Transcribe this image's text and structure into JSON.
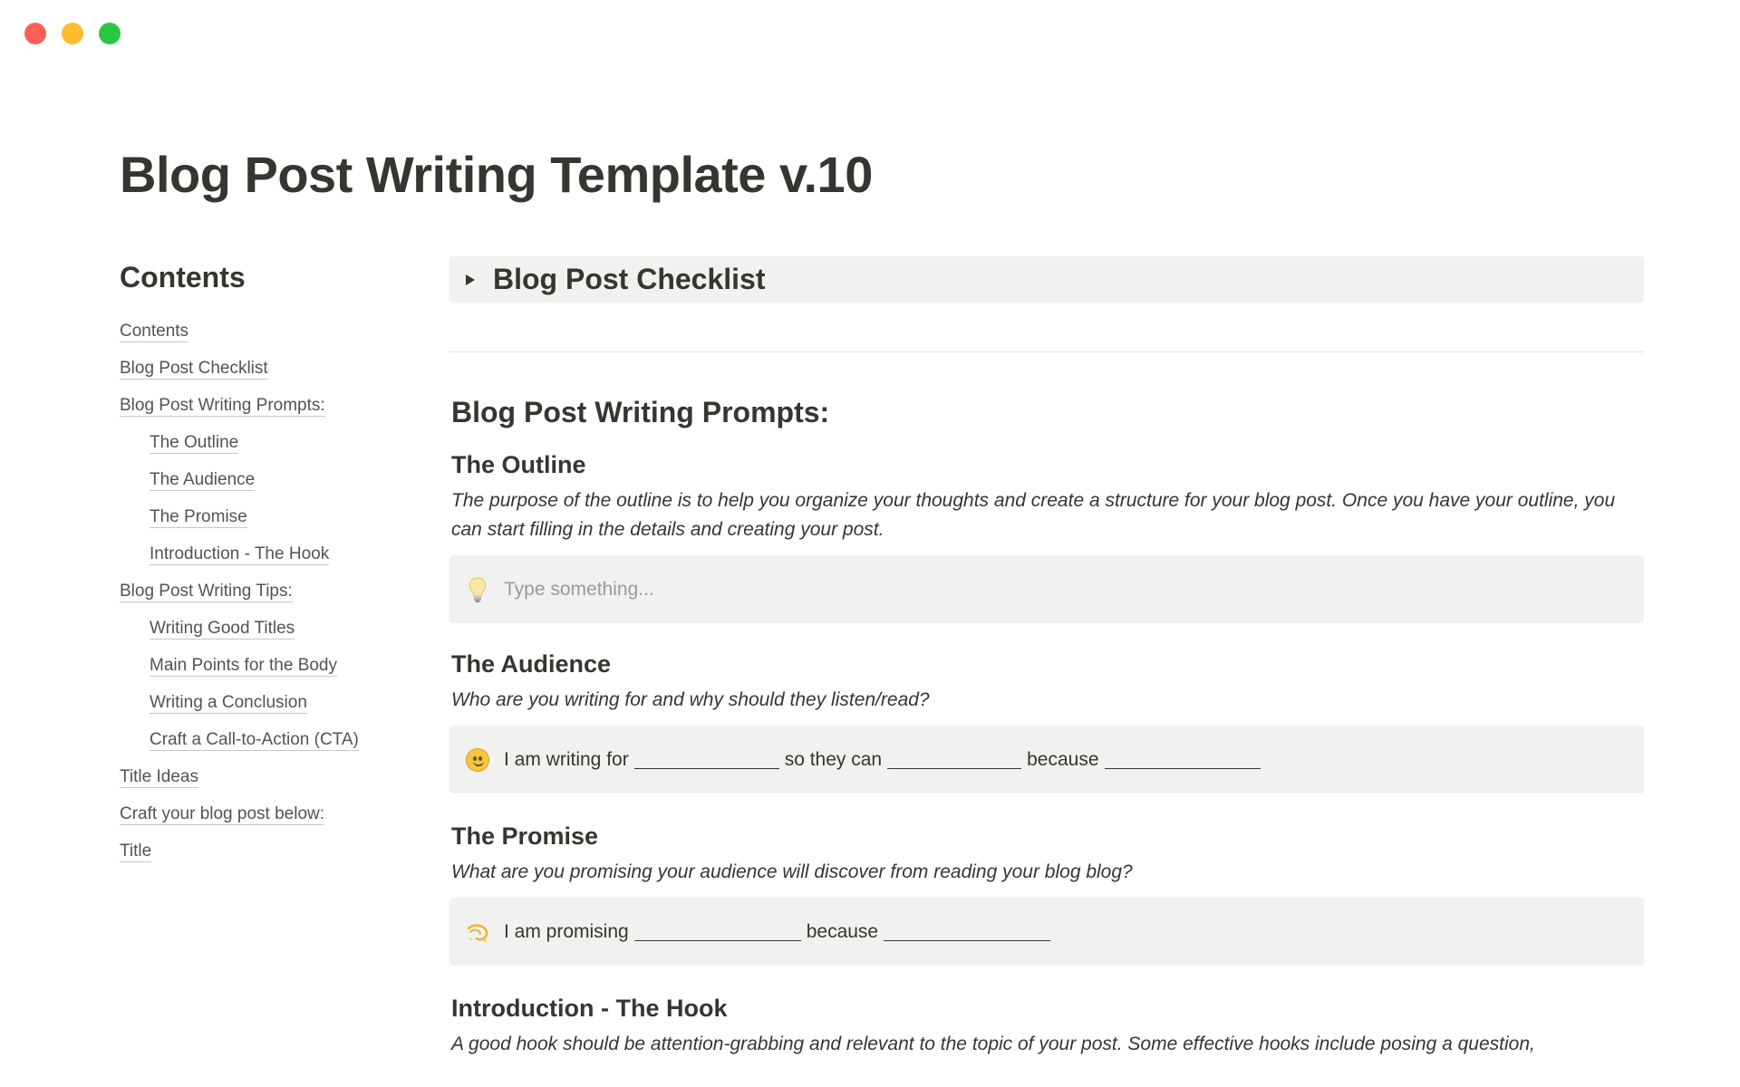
{
  "window": {
    "controls": [
      "close",
      "minimize",
      "zoom"
    ]
  },
  "page": {
    "title": "Blog Post Writing Template v.10"
  },
  "toc": {
    "heading": "Contents",
    "items": [
      {
        "label": "Contents",
        "indent": false
      },
      {
        "label": "Blog Post Checklist",
        "indent": false
      },
      {
        "label": "Blog Post Writing Prompts:",
        "indent": false
      },
      {
        "label": "The Outline",
        "indent": true
      },
      {
        "label": "The Audience",
        "indent": true
      },
      {
        "label": "The Promise",
        "indent": true
      },
      {
        "label": "Introduction - The Hook",
        "indent": true
      },
      {
        "label": "Blog Post Writing Tips:",
        "indent": false
      },
      {
        "label": "Writing Good Titles",
        "indent": true
      },
      {
        "label": "Main Points for the Body",
        "indent": true
      },
      {
        "label": "Writing a Conclusion",
        "indent": true
      },
      {
        "label": "Craft a Call-to-Action (CTA)",
        "indent": true
      },
      {
        "label": "Title Ideas",
        "indent": false
      },
      {
        "label": "Craft your blog post below:",
        "indent": false
      },
      {
        "label": "Title",
        "indent": false
      }
    ]
  },
  "checklist": {
    "title": "Blog Post Checklist",
    "icon": "triangle-right-icon"
  },
  "prompts": {
    "heading": "Blog Post Writing Prompts:",
    "outline": {
      "title": "The Outline",
      "description": "The purpose of the outline is to help you organize your thoughts and create a structure for your blog post. Once you have your outline, you can start filling in the details and creating your post.",
      "callout_icon": "lightbulb-icon",
      "callout_placeholder": "Type something..."
    },
    "audience": {
      "title": "The Audience",
      "description": "Who are you writing for and why should they listen/read?",
      "callout_icon": "smiley-icon",
      "callout_parts": [
        "I am writing for",
        "so they can",
        "because"
      ]
    },
    "promise": {
      "title": "The Promise",
      "description": "What are you promising your audience will discover from reading your blog blog?",
      "callout_icon": "dizzy-icon",
      "callout_parts": [
        "I am promising",
        "because"
      ]
    },
    "hook": {
      "title": "Introduction - The Hook",
      "description": "A good hook should be attention-grabbing and relevant to the topic of your post. Some effective hooks include posing a question,"
    }
  }
}
